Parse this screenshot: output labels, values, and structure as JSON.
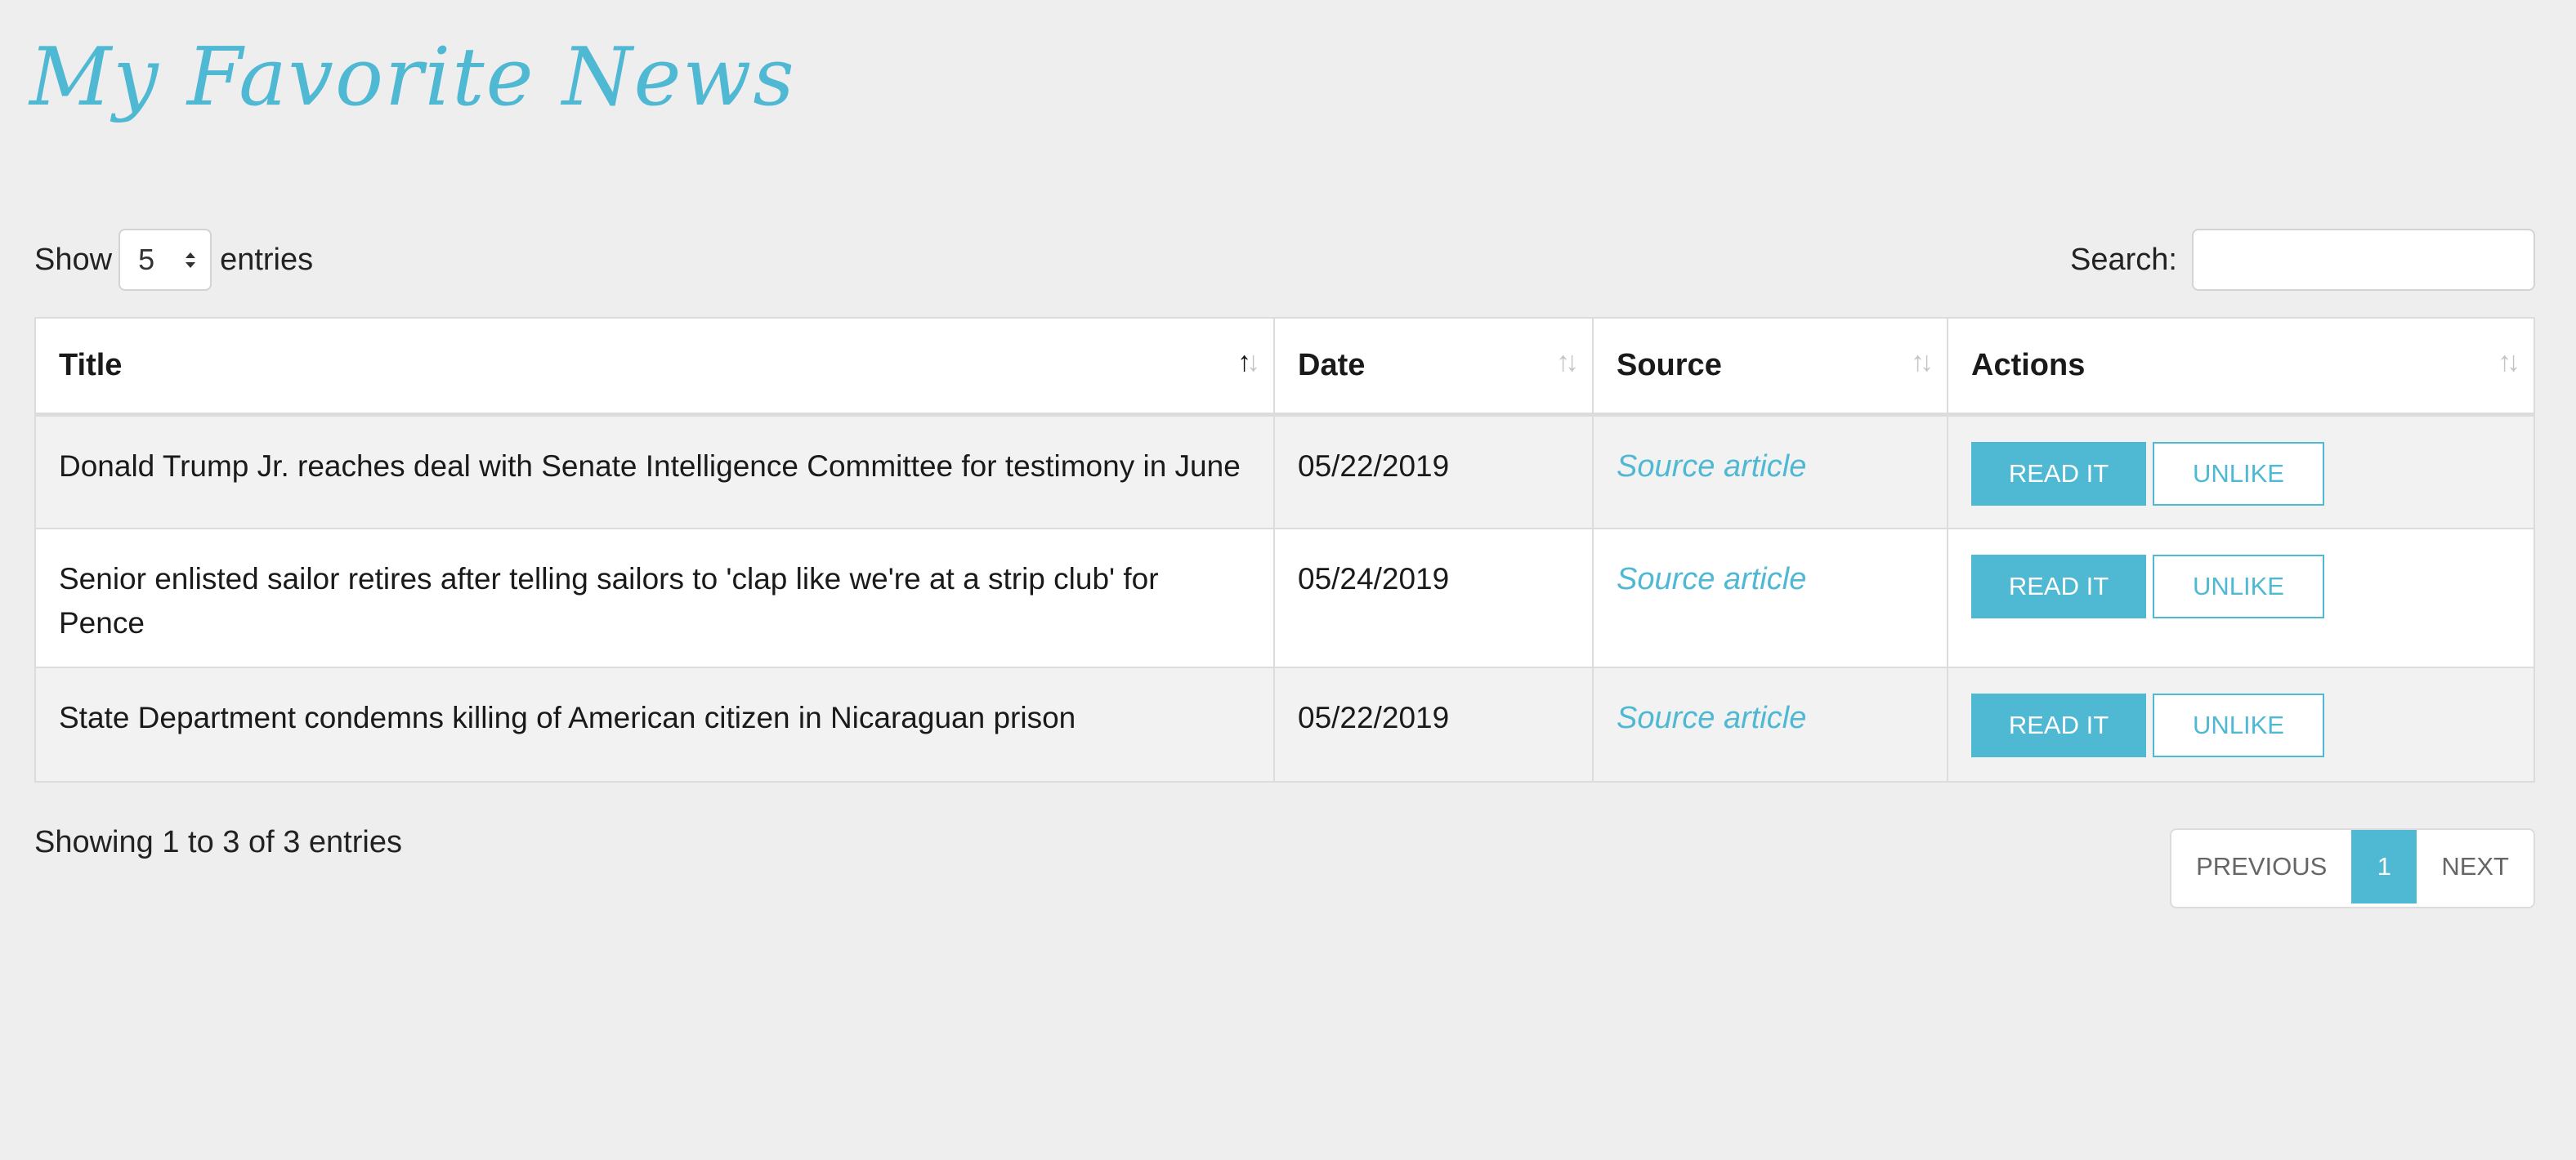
{
  "title": "My Favorite News",
  "length_menu": {
    "prefix": "Show",
    "value": "5",
    "suffix": "entries"
  },
  "search": {
    "label": "Search:",
    "value": ""
  },
  "table": {
    "columns": [
      "Title",
      "Date",
      "Source",
      "Actions"
    ],
    "rows": [
      {
        "title": "Donald Trump Jr. reaches deal with Senate Intelligence Committee for testimony in June",
        "date": "05/22/2019",
        "source": "Source article",
        "read_label": "READ IT",
        "unlike_label": "UNLIKE"
      },
      {
        "title": "Senior enlisted sailor retires after telling sailors to 'clap like we're at a strip club' for Pence",
        "date": "05/24/2019",
        "source": "Source article",
        "read_label": "READ IT",
        "unlike_label": "UNLIKE"
      },
      {
        "title": "State Department condemns killing of American citizen in Nicaraguan prison",
        "date": "05/22/2019",
        "source": "Source article",
        "read_label": "READ IT",
        "unlike_label": "UNLIKE"
      }
    ]
  },
  "info": "Showing 1 to 3 of 3 entries",
  "pagination": {
    "previous": "PREVIOUS",
    "current": "1",
    "next": "NEXT"
  },
  "colors": {
    "accent": "#4fb8d3",
    "background": "#eeeeee",
    "stripe": "#f2f2f2"
  },
  "icons": {
    "sort": "sort-arrows-icon",
    "select": "select-arrows-icon"
  }
}
